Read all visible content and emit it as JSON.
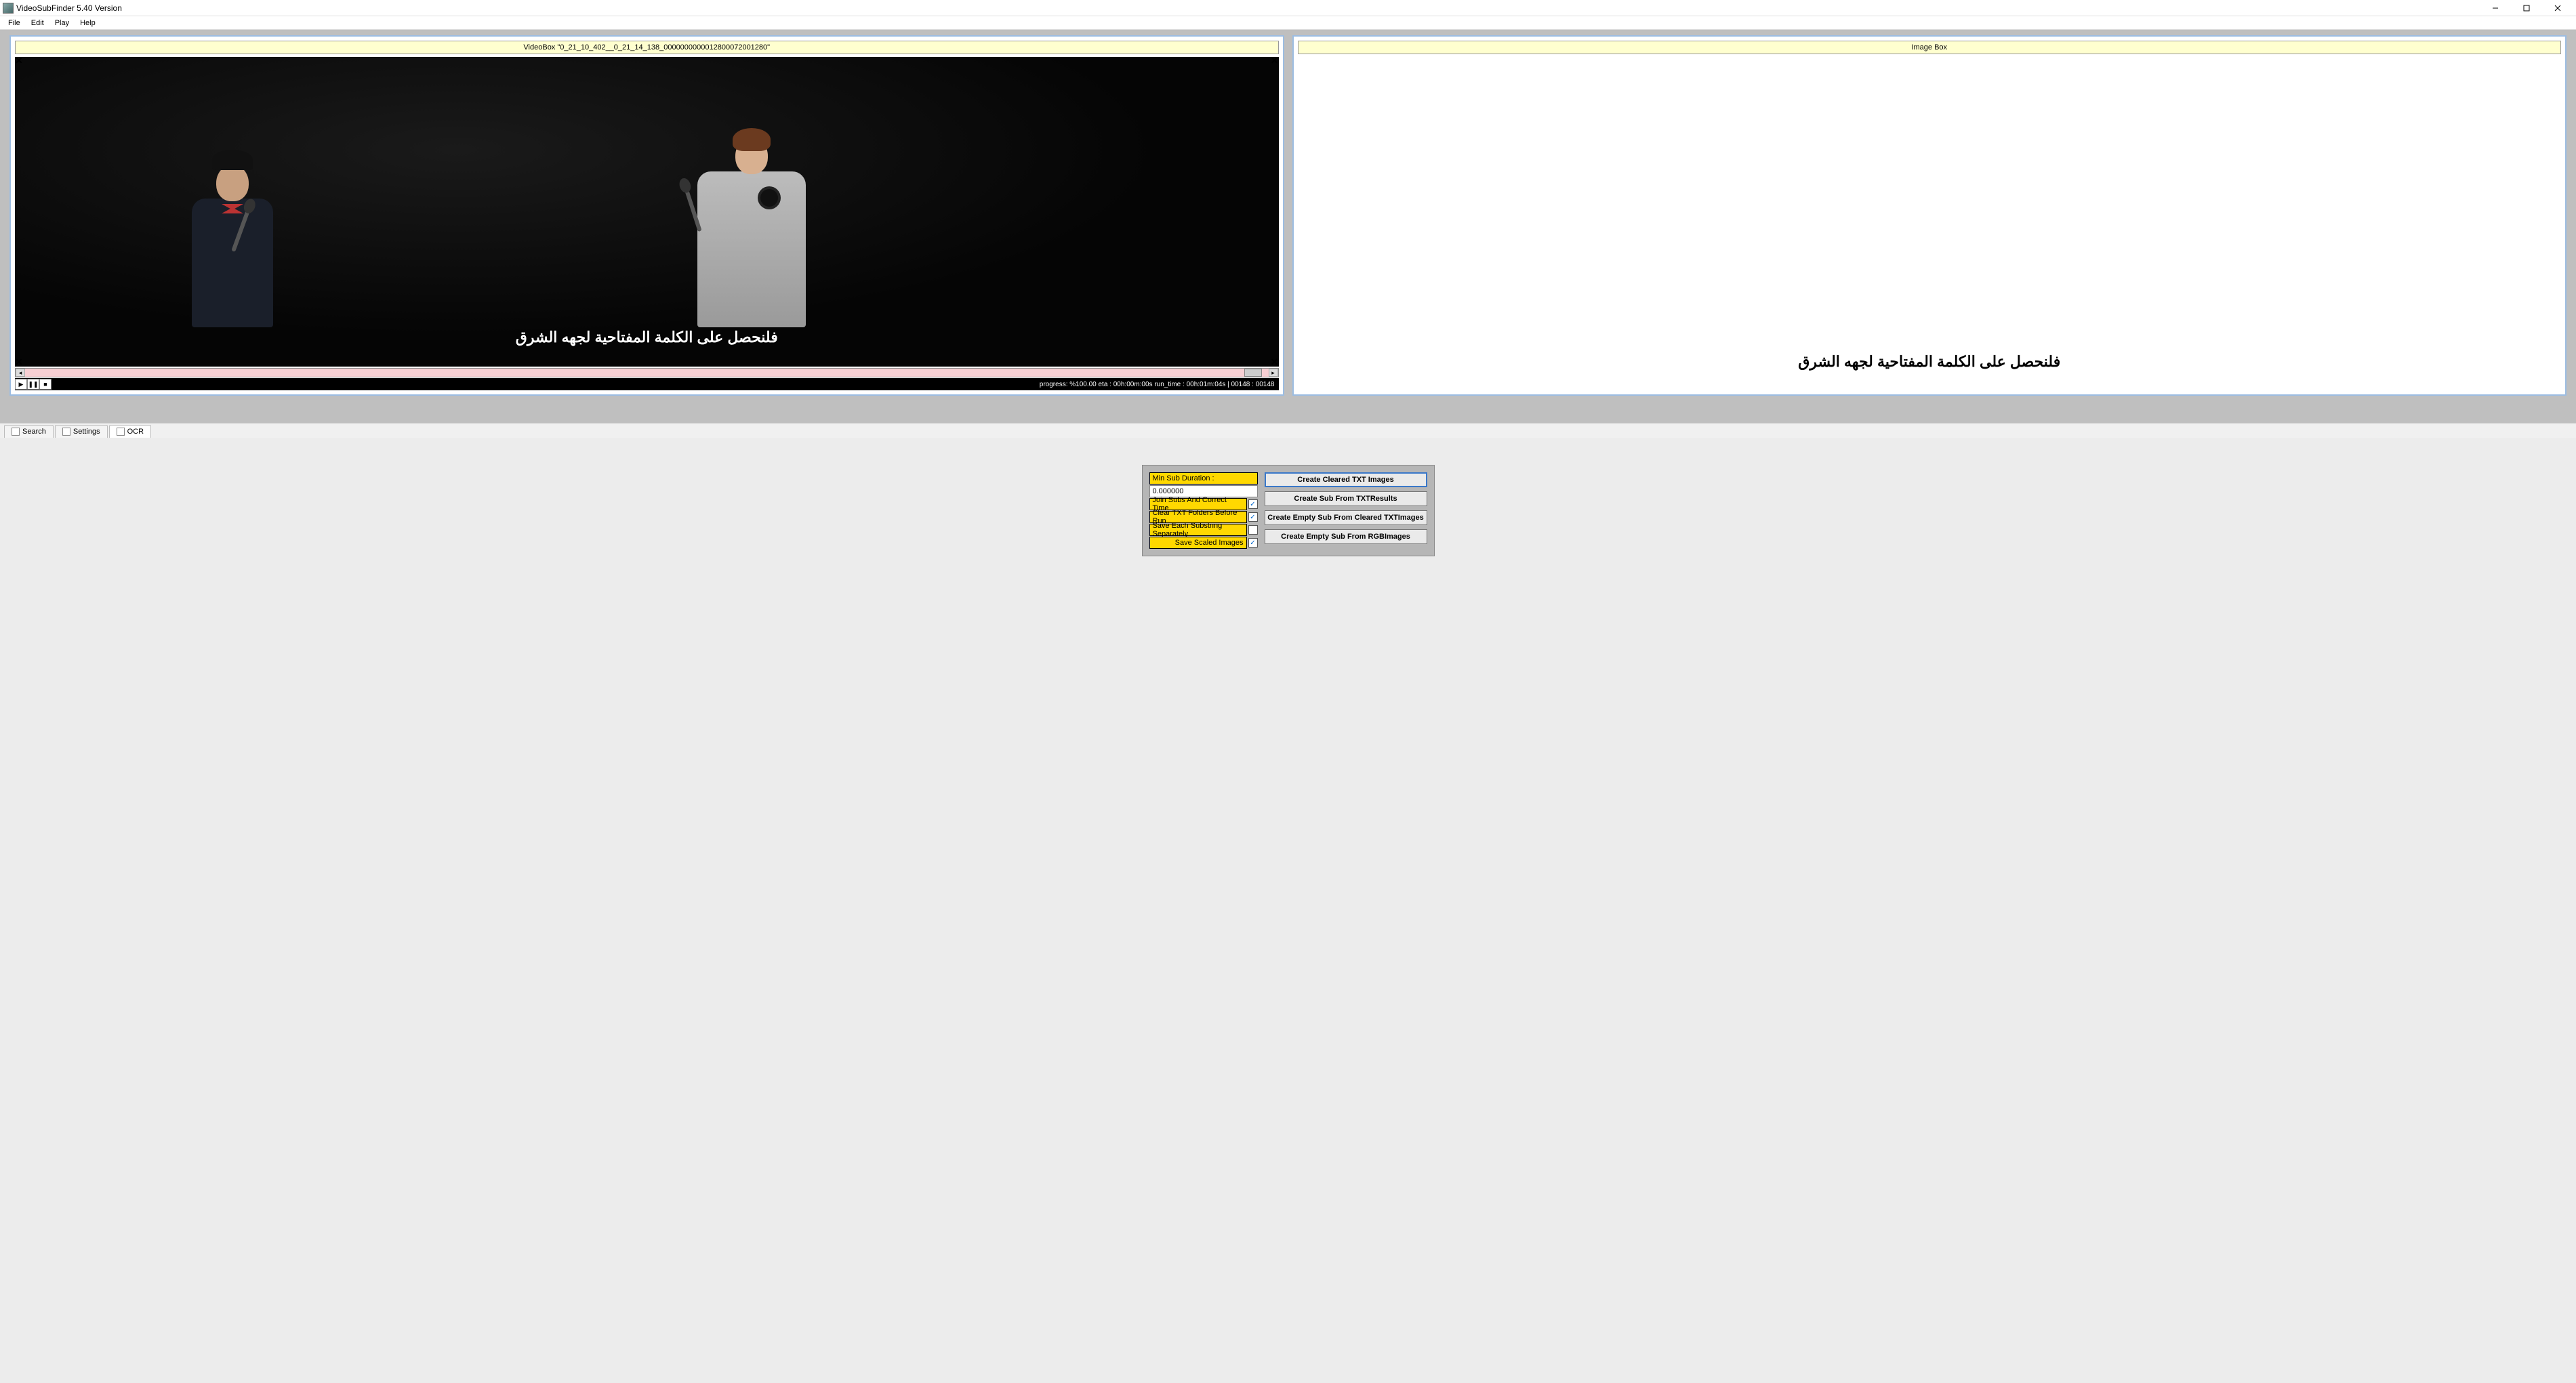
{
  "window": {
    "title": "VideoSubFinder 5.40 Version"
  },
  "menu": {
    "file": "File",
    "edit": "Edit",
    "play": "Play",
    "help": "Help"
  },
  "videoBox": {
    "header": "VideoBox \"0_21_10_402__0_21_14_138_0000000000012800072001280\"",
    "subtitle": "فلنحصل على الكلمة المفتاحية لجهه الشرق",
    "status": "progress: %100.00 eta : 00h:00m:00s run_time : 00h:01m:04s   |   00148 : 00148"
  },
  "imageBox": {
    "header": "Image Box",
    "text": "فلنحصل على الكلمة المفتاحية لجهه الشرق"
  },
  "tabs": {
    "search": "Search",
    "settings": "Settings",
    "ocr": "OCR"
  },
  "ocr": {
    "minSubDurationLabel": "Min Sub Duration :",
    "minSubDurationValue": "0.000000",
    "joinSubs": "Join Subs And Correct Time",
    "clearTxt": "Clear TXT Folders Before Run",
    "saveEach": "Save Each Substring Separately",
    "saveScaled": "Save Scaled Images",
    "joinSubsChecked": true,
    "clearTxtChecked": true,
    "saveEachChecked": false,
    "saveScaledChecked": true,
    "btnCreateCleared": "Create Cleared TXT Images",
    "btnCreateSubTxt": "Create Sub From TXTResults",
    "btnCreateEmptyTxt": "Create Empty Sub From Cleared TXTImages",
    "btnCreateEmptyRgb": "Create Empty Sub From RGBImages"
  }
}
